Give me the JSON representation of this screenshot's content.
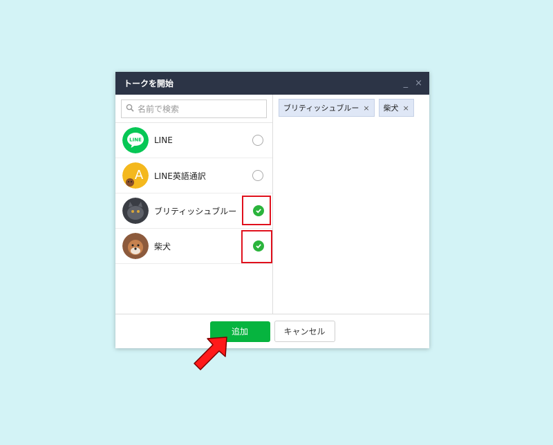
{
  "dialog": {
    "title": "トークを開始",
    "minimize_icon": "_",
    "close_icon": "×"
  },
  "search": {
    "placeholder": "名前で検索",
    "icon": "search-icon"
  },
  "contacts": [
    {
      "name": "LINE",
      "selected": false,
      "avatar": "line-logo"
    },
    {
      "name": "LINE英語通訳",
      "selected": false,
      "avatar": "line-translate-logo"
    },
    {
      "name": "ブリティッシュブルー",
      "selected": true,
      "avatar": "cat-photo"
    },
    {
      "name": "柴犬",
      "selected": true,
      "avatar": "dog-photo"
    }
  ],
  "selected_tags": [
    {
      "label": "ブリティッシュブルー",
      "remove": "×"
    },
    {
      "label": "柴犬",
      "remove": "×"
    }
  ],
  "footer": {
    "add_label": "追加",
    "cancel_label": "キャンセル"
  },
  "colors": {
    "accent": "#06b43f",
    "titlebar": "#2c3446",
    "highlight": "#e0101c",
    "background": "#d3f3f6"
  }
}
